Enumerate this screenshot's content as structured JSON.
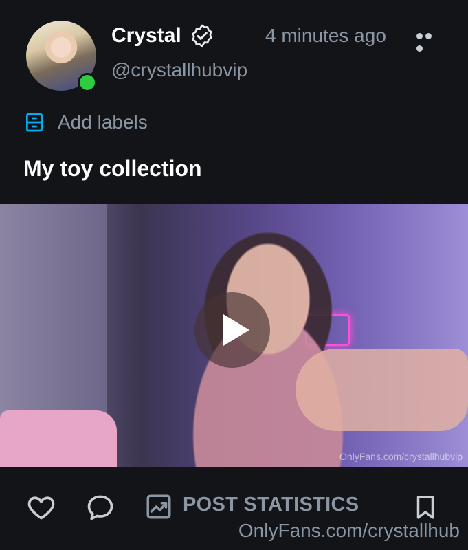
{
  "post": {
    "author_name": "Crystal",
    "handle": "@crystallhubvip",
    "time_ago": "4 minutes ago",
    "add_labels": "Add labels",
    "caption": "My toy collection",
    "media_watermark": "OnlyFans.com/crystallhubvip"
  },
  "actions": {
    "stats_label": "POST STATISTICS"
  },
  "footer": {
    "watermark": "OnlyFans.com/crystallhub"
  },
  "icons": {
    "verified": "verified-badge-icon",
    "more": "more-horizontal-icon",
    "labels": "labels-icon",
    "play": "play-icon",
    "like": "heart-icon",
    "comment": "comment-icon",
    "stats": "chart-icon",
    "bookmark": "bookmark-icon"
  },
  "colors": {
    "background": "#131417",
    "muted_text": "#8a96a3",
    "accent": "#00aff0",
    "online": "#2ecc40"
  }
}
